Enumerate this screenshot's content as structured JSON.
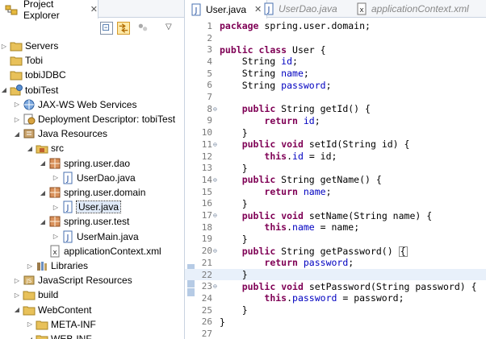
{
  "project_explorer": {
    "title": "Project Explorer",
    "tree": [
      {
        "label": "Servers",
        "depth": 0,
        "icon": "folder-icon",
        "twisty": "collapsed"
      },
      {
        "label": "Tobi",
        "depth": 0,
        "icon": "folder-icon",
        "twisty": ""
      },
      {
        "label": "tobiJDBC",
        "depth": 0,
        "icon": "folder-icon",
        "twisty": ""
      },
      {
        "label": "tobiTest",
        "depth": 0,
        "icon": "web-project-icon",
        "twisty": "expanded"
      },
      {
        "label": "JAX-WS Web Services",
        "depth": 1,
        "icon": "web-services-icon",
        "twisty": "collapsed"
      },
      {
        "label": "Deployment Descriptor: tobiTest",
        "depth": 1,
        "icon": "deployment-descriptor-icon",
        "twisty": "collapsed"
      },
      {
        "label": "Java Resources",
        "depth": 1,
        "icon": "java-resources-icon",
        "twisty": "expanded"
      },
      {
        "label": "src",
        "depth": 2,
        "icon": "source-folder-icon",
        "twisty": "expanded"
      },
      {
        "label": "spring.user.dao",
        "depth": 3,
        "icon": "package-icon",
        "twisty": "expanded"
      },
      {
        "label": "UserDao.java",
        "depth": 4,
        "icon": "java-file-icon",
        "twisty": "collapsed"
      },
      {
        "label": "spring.user.domain",
        "depth": 3,
        "icon": "package-icon",
        "twisty": "expanded"
      },
      {
        "label": "User.java",
        "depth": 4,
        "icon": "java-file-icon",
        "twisty": "collapsed",
        "selected": true
      },
      {
        "label": "spring.user.test",
        "depth": 3,
        "icon": "package-icon",
        "twisty": "expanded"
      },
      {
        "label": "UserMain.java",
        "depth": 4,
        "icon": "java-file-icon",
        "twisty": "collapsed"
      },
      {
        "label": "applicationContext.xml",
        "depth": 3,
        "icon": "xml-file-icon",
        "twisty": ""
      },
      {
        "label": "Libraries",
        "depth": 2,
        "icon": "libraries-icon",
        "twisty": "collapsed"
      },
      {
        "label": "JavaScript Resources",
        "depth": 1,
        "icon": "javascript-resources-icon",
        "twisty": "collapsed"
      },
      {
        "label": "build",
        "depth": 1,
        "icon": "folder-icon",
        "twisty": "collapsed"
      },
      {
        "label": "WebContent",
        "depth": 1,
        "icon": "folder-icon",
        "twisty": "expanded"
      },
      {
        "label": "META-INF",
        "depth": 2,
        "icon": "folder-icon",
        "twisty": "collapsed"
      },
      {
        "label": "WEB-INF",
        "depth": 2,
        "icon": "folder-icon",
        "twisty": "expanded"
      }
    ]
  },
  "editor": {
    "tabs": [
      {
        "label": "User.java",
        "active": true,
        "icon": "java-file-icon"
      },
      {
        "label": "UserDao.java",
        "active": false,
        "icon": "java-file-icon"
      },
      {
        "label": "applicationContext.xml",
        "active": false,
        "icon": "xml-file-icon"
      }
    ],
    "lines": [
      {
        "n": "1",
        "t": [
          [
            "k",
            "package"
          ],
          [
            "p",
            " spring.user.domain;"
          ]
        ]
      },
      {
        "n": "2",
        "t": []
      },
      {
        "n": "3",
        "t": [
          [
            "k",
            "public"
          ],
          [
            "p",
            " "
          ],
          [
            "k",
            "class"
          ],
          [
            "p",
            " User {"
          ]
        ]
      },
      {
        "n": "4",
        "t": [
          [
            "p",
            "    String "
          ],
          [
            "f",
            "id"
          ],
          [
            "p",
            ";"
          ]
        ]
      },
      {
        "n": "5",
        "t": [
          [
            "p",
            "    String "
          ],
          [
            "f",
            "name"
          ],
          [
            "p",
            ";"
          ]
        ]
      },
      {
        "n": "6",
        "t": [
          [
            "p",
            "    String "
          ],
          [
            "f",
            "password"
          ],
          [
            "p",
            ";"
          ]
        ]
      },
      {
        "n": "7",
        "t": []
      },
      {
        "n": "8",
        "fold": true,
        "t": [
          [
            "p",
            "    "
          ],
          [
            "k",
            "public"
          ],
          [
            "p",
            " String getId() {"
          ]
        ]
      },
      {
        "n": "9",
        "t": [
          [
            "p",
            "        "
          ],
          [
            "k",
            "return"
          ],
          [
            "p",
            " "
          ],
          [
            "f",
            "id"
          ],
          [
            "p",
            ";"
          ]
        ]
      },
      {
        "n": "10",
        "t": [
          [
            "p",
            "    }"
          ]
        ]
      },
      {
        "n": "11",
        "fold": true,
        "t": [
          [
            "p",
            "    "
          ],
          [
            "k",
            "public"
          ],
          [
            "p",
            " "
          ],
          [
            "k",
            "void"
          ],
          [
            "p",
            " setId(String id) {"
          ]
        ]
      },
      {
        "n": "12",
        "t": [
          [
            "p",
            "        "
          ],
          [
            "k",
            "this"
          ],
          [
            "p",
            "."
          ],
          [
            "f",
            "id"
          ],
          [
            "p",
            " = id;"
          ]
        ]
      },
      {
        "n": "13",
        "t": [
          [
            "p",
            "    }"
          ]
        ]
      },
      {
        "n": "14",
        "fold": true,
        "t": [
          [
            "p",
            "    "
          ],
          [
            "k",
            "public"
          ],
          [
            "p",
            " String getName() {"
          ]
        ]
      },
      {
        "n": "15",
        "t": [
          [
            "p",
            "        "
          ],
          [
            "k",
            "return"
          ],
          [
            "p",
            " "
          ],
          [
            "f",
            "name"
          ],
          [
            "p",
            ";"
          ]
        ]
      },
      {
        "n": "16",
        "t": [
          [
            "p",
            "    }"
          ]
        ]
      },
      {
        "n": "17",
        "fold": true,
        "t": [
          [
            "p",
            "    "
          ],
          [
            "k",
            "public"
          ],
          [
            "p",
            " "
          ],
          [
            "k",
            "void"
          ],
          [
            "p",
            " setName(String name) {"
          ]
        ]
      },
      {
        "n": "18",
        "t": [
          [
            "p",
            "        "
          ],
          [
            "k",
            "this"
          ],
          [
            "p",
            "."
          ],
          [
            "f",
            "name"
          ],
          [
            "p",
            " = name;"
          ]
        ]
      },
      {
        "n": "19",
        "t": [
          [
            "p",
            "    }"
          ]
        ]
      },
      {
        "n": "20",
        "fold": true,
        "t": [
          [
            "p",
            "    "
          ],
          [
            "k",
            "public"
          ],
          [
            "p",
            " String getPassword() "
          ],
          [
            "c",
            "{"
          ]
        ]
      },
      {
        "n": "21",
        "t": [
          [
            "p",
            "        "
          ],
          [
            "k",
            "return"
          ],
          [
            "p",
            " "
          ],
          [
            "f",
            "password"
          ],
          [
            "p",
            ";"
          ]
        ]
      },
      {
        "n": "22",
        "current": true,
        "t": [
          [
            "p",
            "    }"
          ]
        ]
      },
      {
        "n": "23",
        "fold": true,
        "t": [
          [
            "p",
            "    "
          ],
          [
            "k",
            "public"
          ],
          [
            "p",
            " "
          ],
          [
            "k",
            "void"
          ],
          [
            "p",
            " setPassword(String password) {"
          ]
        ]
      },
      {
        "n": "24",
        "t": [
          [
            "p",
            "        "
          ],
          [
            "k",
            "this"
          ],
          [
            "p",
            "."
          ],
          [
            "f",
            "password"
          ],
          [
            "p",
            " = password;"
          ]
        ]
      },
      {
        "n": "25",
        "t": [
          [
            "p",
            "    }"
          ]
        ]
      },
      {
        "n": "26",
        "t": [
          [
            "p",
            "}"
          ]
        ]
      },
      {
        "n": "27",
        "t": []
      }
    ]
  }
}
